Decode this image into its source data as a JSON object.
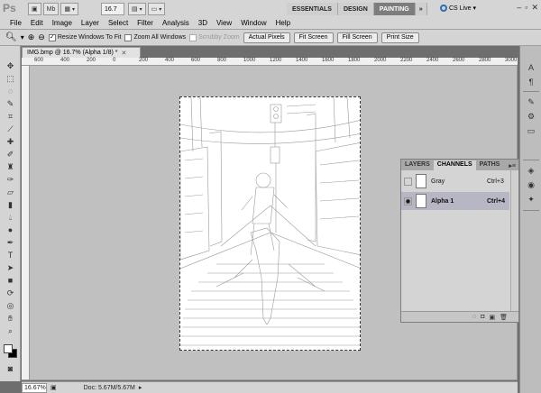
{
  "app": {
    "logo": "Ps",
    "buttons": [
      {
        "label": "Mb"
      },
      {
        "label": "16.7"
      }
    ],
    "workspaces": [
      "ESSENTIALS",
      "DESIGN",
      "PAINTING"
    ],
    "active_workspace": "PAINTING",
    "cs_live": "CS Live"
  },
  "menu": [
    "File",
    "Edit",
    "Image",
    "Layer",
    "Select",
    "Filter",
    "Analysis",
    "3D",
    "View",
    "Window",
    "Help"
  ],
  "options": {
    "resize_windows": "Resize Windows To Fit",
    "zoom_all": "Zoom All Windows",
    "scrubby": "Scrubby Zoom",
    "actual_pixels": "Actual Pixels",
    "fit_screen": "Fit Screen",
    "fill_screen": "Fill Screen",
    "print_size": "Print Size"
  },
  "document": {
    "tab_title": "IMG.bmp @ 16.7% (Alpha 1/8) *",
    "ruler_marks": [
      "600",
      "400",
      "200",
      "0",
      "200",
      "400",
      "600",
      "800",
      "1000",
      "1200",
      "1400",
      "1600",
      "1800",
      "2000",
      "2200",
      "2400",
      "2600",
      "2800",
      "3000"
    ]
  },
  "status": {
    "zoom": "16.67%",
    "doc_size": "Doc: 5.67M/5.67M"
  },
  "channels_panel": {
    "tabs": [
      "LAYERS",
      "CHANNELS",
      "PATHS"
    ],
    "active_tab": "CHANNELS",
    "rows": [
      {
        "name": "Gray",
        "shortcut": "Ctrl+3"
      },
      {
        "name": "Alpha 1",
        "shortcut": "Ctrl+4"
      }
    ]
  },
  "colors": {
    "accent": "#2d6fb5",
    "selected_row": "#b6b6c4"
  }
}
